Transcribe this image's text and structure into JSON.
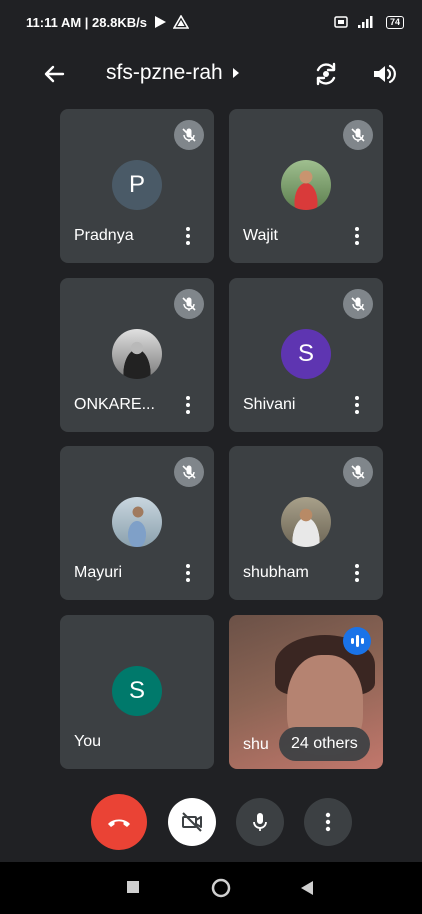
{
  "status_bar": {
    "time_speed": "11:11 AM | 28.8KB/s",
    "battery": "74"
  },
  "header": {
    "meeting_code": "sfs-pzne-rah"
  },
  "participants": [
    {
      "name": "Pradnya",
      "initial": "P",
      "avatar_color": "#4a5a67",
      "muted": true
    },
    {
      "name": "Wajit",
      "initial": "",
      "avatar_color": "",
      "muted": true
    },
    {
      "name": "ONKARE...",
      "initial": "",
      "avatar_color": "",
      "muted": true
    },
    {
      "name": "Shivani",
      "initial": "S",
      "avatar_color": "#5e35b1",
      "muted": true
    },
    {
      "name": "Mayuri",
      "initial": "",
      "avatar_color": "",
      "muted": true
    },
    {
      "name": "shubham",
      "initial": "",
      "avatar_color": "",
      "muted": true
    },
    {
      "name": "You",
      "initial": "S",
      "avatar_color": "#00796b",
      "muted": false
    }
  ],
  "overflow_tile": {
    "name_partial": "shu",
    "others_label": "24 others"
  },
  "colors": {
    "background": "#202124",
    "tile": "#3c4043",
    "end_call": "#ea4335",
    "speaking": "#1a73e8"
  }
}
